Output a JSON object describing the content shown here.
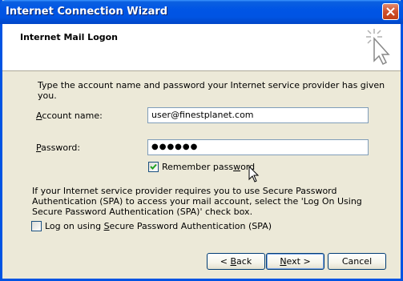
{
  "window": {
    "title": "Internet Connection Wizard"
  },
  "header": {
    "title": "Internet Mail Logon",
    "icon": "wizard-wand-icon"
  },
  "intro": "Type the account name and password your Internet service provider has given you.",
  "fields": {
    "account": {
      "label_u": "A",
      "label_rest": "ccount name:",
      "value": "user@finestplanet.com"
    },
    "password": {
      "label_u": "P",
      "label_rest": "assword:",
      "value": "●●●●●●"
    }
  },
  "remember": {
    "checked": true,
    "label_pre": "Remember pass",
    "label_u": "w",
    "label_post": "ord"
  },
  "spa": {
    "description": "If your Internet service provider requires you to use Secure Password Authentication (SPA) to access your mail account, select the 'Log On Using Secure Password Authentication (SPA)' check box.",
    "checked": false,
    "label_pre": "Log on using ",
    "label_u": "S",
    "label_post": "ecure Password Authentication (SPA)"
  },
  "buttons": {
    "back": {
      "prefix": "< ",
      "u": "B",
      "rest": "ack"
    },
    "next": {
      "u": "N",
      "rest": "ext >"
    },
    "cancel": {
      "label": "Cancel"
    }
  },
  "colors": {
    "titlebar": "#0054e3",
    "dialog_bg": "#ece9d8",
    "check": "#21a121"
  }
}
